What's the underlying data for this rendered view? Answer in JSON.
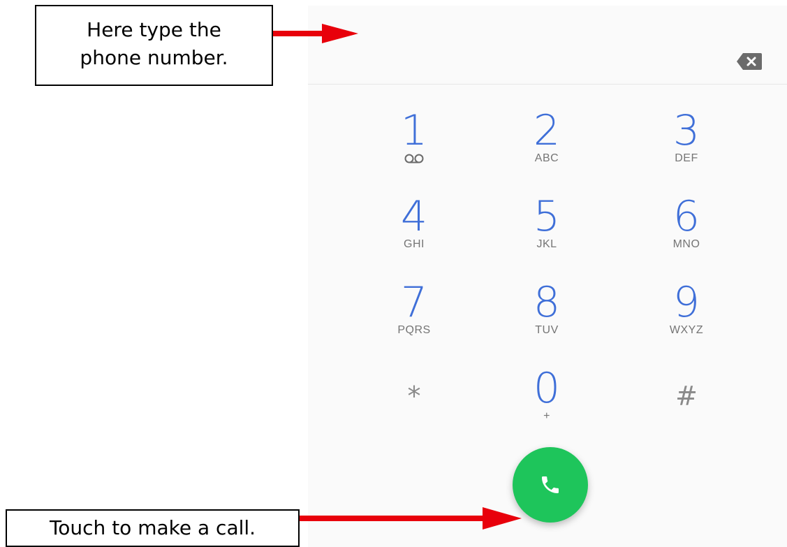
{
  "annotations": {
    "top_text_line1": "Here type the",
    "top_text_line2": "phone number.",
    "bottom_text": "Touch to make a call."
  },
  "dialer": {
    "number_value": "",
    "backspace_icon": "backspace-icon",
    "keys": [
      {
        "digit": "1",
        "letters": "",
        "icon": "voicemail-icon"
      },
      {
        "digit": "2",
        "letters": "ABC"
      },
      {
        "digit": "3",
        "letters": "DEF"
      },
      {
        "digit": "4",
        "letters": "GHI"
      },
      {
        "digit": "5",
        "letters": "JKL"
      },
      {
        "digit": "6",
        "letters": "MNO"
      },
      {
        "digit": "7",
        "letters": "PQRS"
      },
      {
        "digit": "8",
        "letters": "TUV"
      },
      {
        "digit": "9",
        "letters": "WXYZ"
      },
      {
        "digit": "*",
        "letters": ""
      },
      {
        "digit": "0",
        "letters": "+"
      },
      {
        "digit": "#",
        "letters": ""
      }
    ],
    "call_icon": "phone-icon"
  },
  "colors": {
    "digit_blue": "#3f6fd8",
    "call_green": "#1ec55b",
    "arrow_red": "#e8000b"
  }
}
